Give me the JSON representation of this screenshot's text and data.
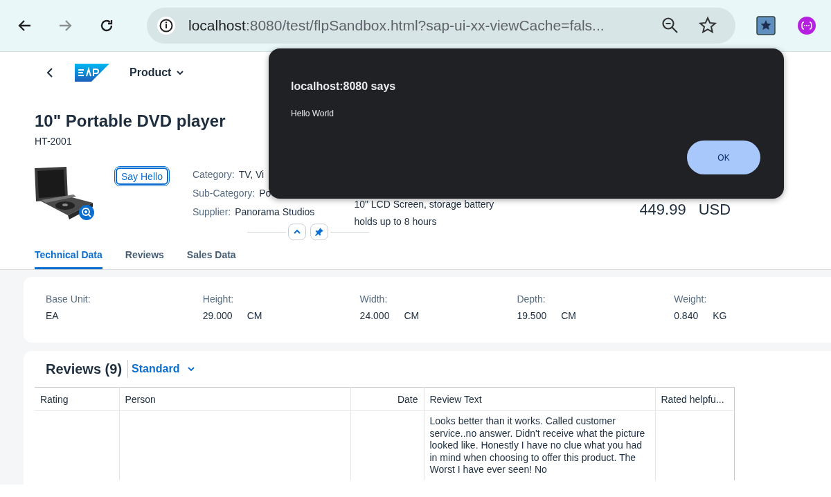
{
  "browser": {
    "url_host": "localhost",
    "url_rest": ":8080/test/flpSandbox.html?sap-ui-xx-viewCache=fals..."
  },
  "shell": {
    "title": "Product"
  },
  "header": {
    "title": "10\" Portable DVD player",
    "subtitle": "HT-2001",
    "button": "Say Hello",
    "fields": [
      {
        "label": "Category:",
        "value": "TV, Vi"
      },
      {
        "label": "Sub-Category:",
        "value": "Po"
      },
      {
        "label": "Supplier:",
        "value": "Panorama Studios"
      }
    ],
    "description": [
      "10\" LCD Screen, storage battery",
      "holds up to 8 hours"
    ],
    "price": "449.99",
    "currency": "USD"
  },
  "tabs": [
    {
      "label": "Technical Data",
      "selected": true
    },
    {
      "label": "Reviews",
      "selected": false
    },
    {
      "label": "Sales Data",
      "selected": false
    }
  ],
  "technical": [
    {
      "label": "Base Unit:",
      "value": "EA"
    },
    {
      "label": "Height:",
      "value": "29.000",
      "unit": "CM"
    },
    {
      "label": "Width:",
      "value": "24.000",
      "unit": "CM"
    },
    {
      "label": "Depth:",
      "value": "19.500",
      "unit": "CM"
    },
    {
      "label": "Weight:",
      "value": "0.840",
      "unit": "KG"
    }
  ],
  "reviews": {
    "title": "Reviews (9)",
    "variant": "Standard",
    "columns": [
      "Rating",
      "Person",
      "Date",
      "Review Text",
      "Rated helpfu..."
    ],
    "rows": [
      {
        "review_text": "Looks better than it works.  Called customer service..no answer.  Didn't receive what the picture looked like.  Honestly I have no clue what you had in mind when choosing to offer this product.  The Worst I have ever seen!  No"
      }
    ]
  },
  "dialog": {
    "title": "localhost:8080 says",
    "message": "Hello World",
    "button": "OK"
  }
}
